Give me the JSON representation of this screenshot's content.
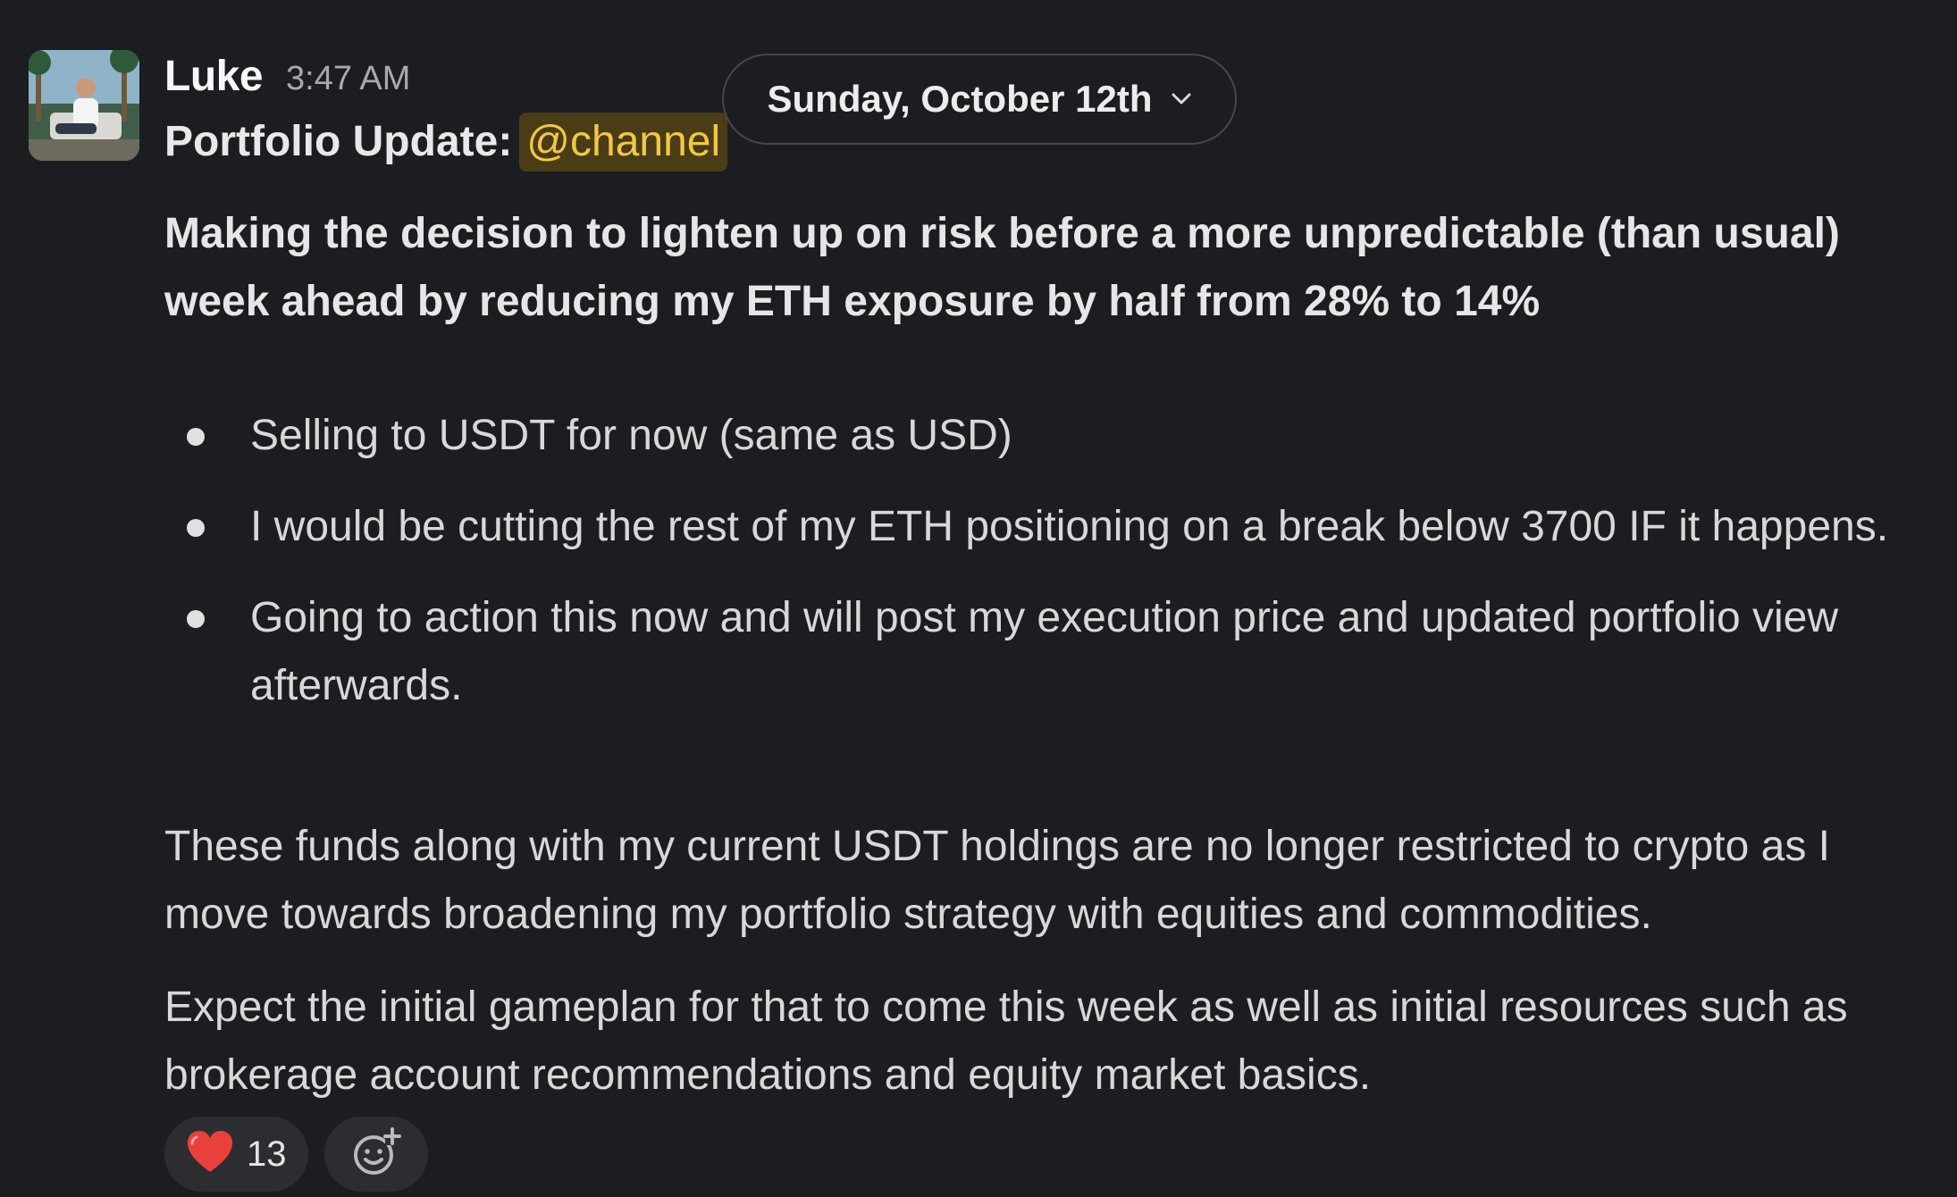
{
  "message": {
    "author": "Luke",
    "time": "3:47 AM",
    "subject_prefix": "Portfolio Update:",
    "mention": "@channel",
    "lead_text": "Making the decision to lighten up on risk before a more unpredictable (than usual) week ahead by reducing my ETH exposure by half from 28% to 14%",
    "bullets": [
      "Selling to USDT for now (same as USD)",
      "I would be cutting the rest of my ETH positioning on a break below 3700 IF it happens.",
      "Going to action this now and will post my execution price and updated portfolio view afterwards."
    ],
    "paragraphs": [
      "These funds along with my current USDT holdings are no longer restricted to crypto as I move towards broadening my portfolio strategy with equities and commodities.",
      "Expect the initial gameplan for that to come this week as well as initial resources such as brokerage account recommendations and equity market basics."
    ],
    "reactions": [
      {
        "icon": "heart-icon",
        "count": "13"
      }
    ],
    "add_reaction_icon": "add-emoji-icon"
  },
  "date_divider": {
    "label": "Sunday, October 12th",
    "icon": "chevron-down-icon"
  },
  "colors": {
    "background": "#1b1d21",
    "mention_text": "#f2c744",
    "mention_bg": "#4a3d16",
    "heart": "#e8413c"
  }
}
